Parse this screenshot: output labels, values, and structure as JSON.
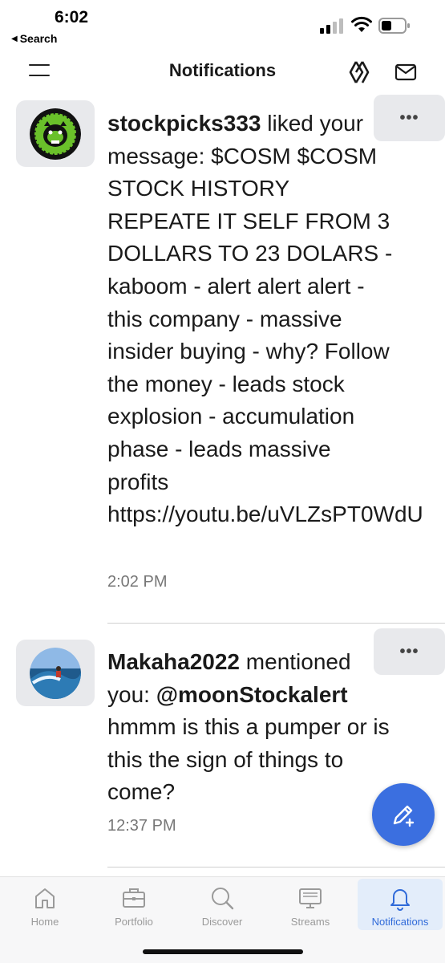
{
  "status_bar": {
    "time": "6:02",
    "back_label": "Search"
  },
  "header": {
    "title": "Notifications"
  },
  "notifications": [
    {
      "username": "stockpicks333",
      "action": " liked your message: $COSM $COSM STOCK HISTORY REPEATE IT SELF FROM 3 DOLLARS TO 23 DOLARS - kaboom - alert alert alert - this company - massive insider buying - why? Follow the money - leads stock explosion - accumulation phase - leads massive profits https://youtu.be/uVLZsPT0WdU",
      "time": "2:02 PM"
    },
    {
      "username": "Makaha2022",
      "action": " mentioned you: ",
      "mention": "@moonStockalert",
      "message": " hmmm is this a pumper or is this the sign of things to come?",
      "time": "12:37 PM"
    }
  ],
  "more_label": "•••",
  "tabs": [
    {
      "label": "Home",
      "icon": "home-icon"
    },
    {
      "label": "Portfolio",
      "icon": "briefcase-icon"
    },
    {
      "label": "Discover",
      "icon": "search-icon"
    },
    {
      "label": "Streams",
      "icon": "monitor-icon"
    },
    {
      "label": "Notifications",
      "icon": "bell-icon",
      "active": true
    }
  ],
  "colors": {
    "accent": "#3b6fe0",
    "active_tab_bg": "#e3edfa",
    "avatar_bg": "#e8e9ec"
  }
}
